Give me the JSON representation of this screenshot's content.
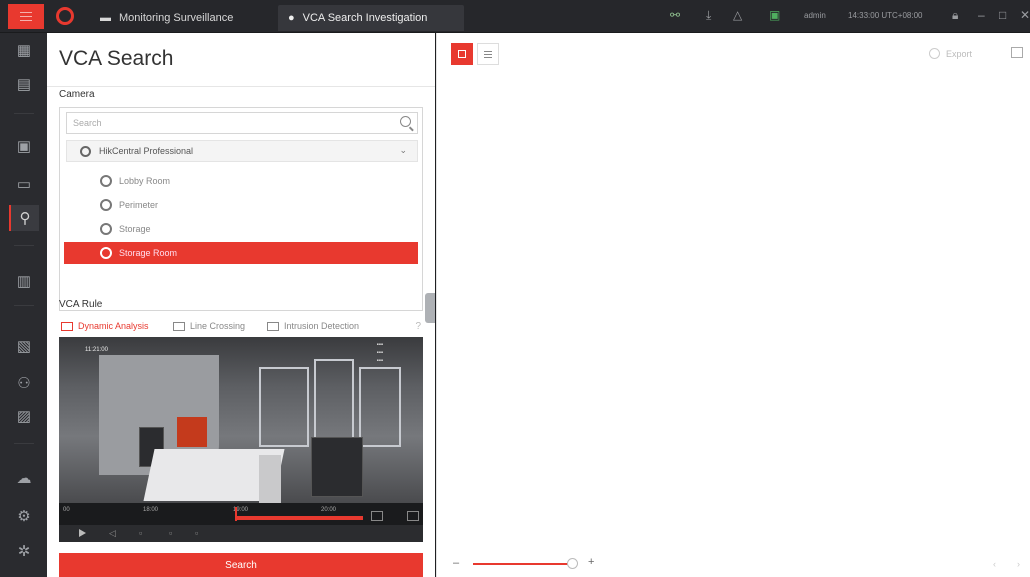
{
  "tabs": [
    {
      "label": "Monitoring Surveillance",
      "icon": "monitor-icon"
    },
    {
      "label": "VCA Search Investigation",
      "icon": "bulb-icon"
    }
  ],
  "topbar": {
    "user": "admin",
    "time": "14:33:00 UTC+08:00"
  },
  "panel": {
    "title": "VCA Search",
    "camera_label": "Camera",
    "search_placeholder": "Search",
    "group": "HikCentral Professional",
    "cameras": [
      "Lobby Room",
      "Perimeter",
      "Storage",
      "Storage Room"
    ],
    "selected_camera": "Storage Room",
    "vca_rule_label": "VCA Rule",
    "rules": [
      "Dynamic Analysis",
      "Line Crossing",
      "Intrusion Detection"
    ],
    "active_rule": "Dynamic Analysis",
    "video": {
      "timestamp": "11:21:00",
      "timeline_ticks": [
        "00",
        "18:00",
        "19:00",
        "20:00"
      ]
    },
    "search_button": "Search"
  },
  "main": {
    "export_label": "Export"
  },
  "colors": {
    "accent": "#e8392f",
    "topbar": "#26272b",
    "sidenav": "#2a2b2f"
  }
}
